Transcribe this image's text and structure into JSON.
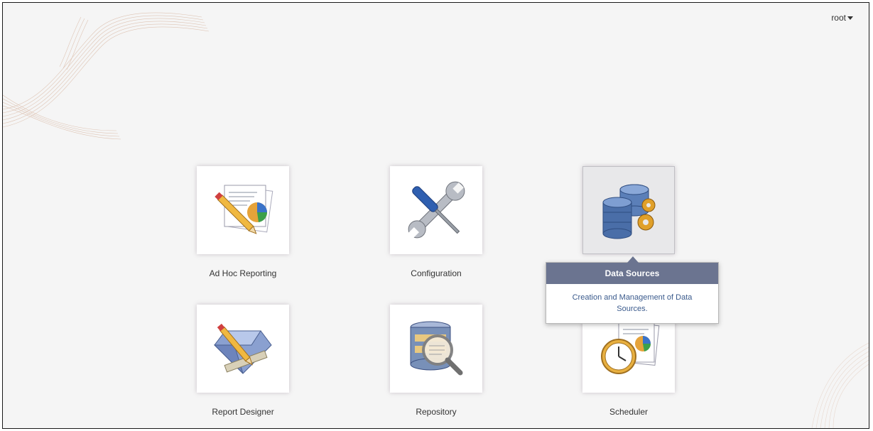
{
  "header": {
    "user_label": "root"
  },
  "tiles": [
    {
      "label": "Ad Hoc Reporting",
      "icon": "ad-hoc-report-icon"
    },
    {
      "label": "Configuration",
      "icon": "wrench-screwdriver-icon"
    },
    {
      "label": "Data Sources",
      "icon": "database-gears-icon"
    },
    {
      "label": "Report Designer",
      "icon": "report-designer-icon"
    },
    {
      "label": "Repository",
      "icon": "repository-search-icon"
    },
    {
      "label": "Scheduler",
      "icon": "scheduler-clock-icon"
    }
  ],
  "tooltip": {
    "title": "Data Sources",
    "description": "Creation and Management of Data Sources."
  },
  "colors": {
    "tooltip_header": "#6b7490",
    "tooltip_text": "#3a5a8c",
    "background": "#f5f5f5"
  }
}
